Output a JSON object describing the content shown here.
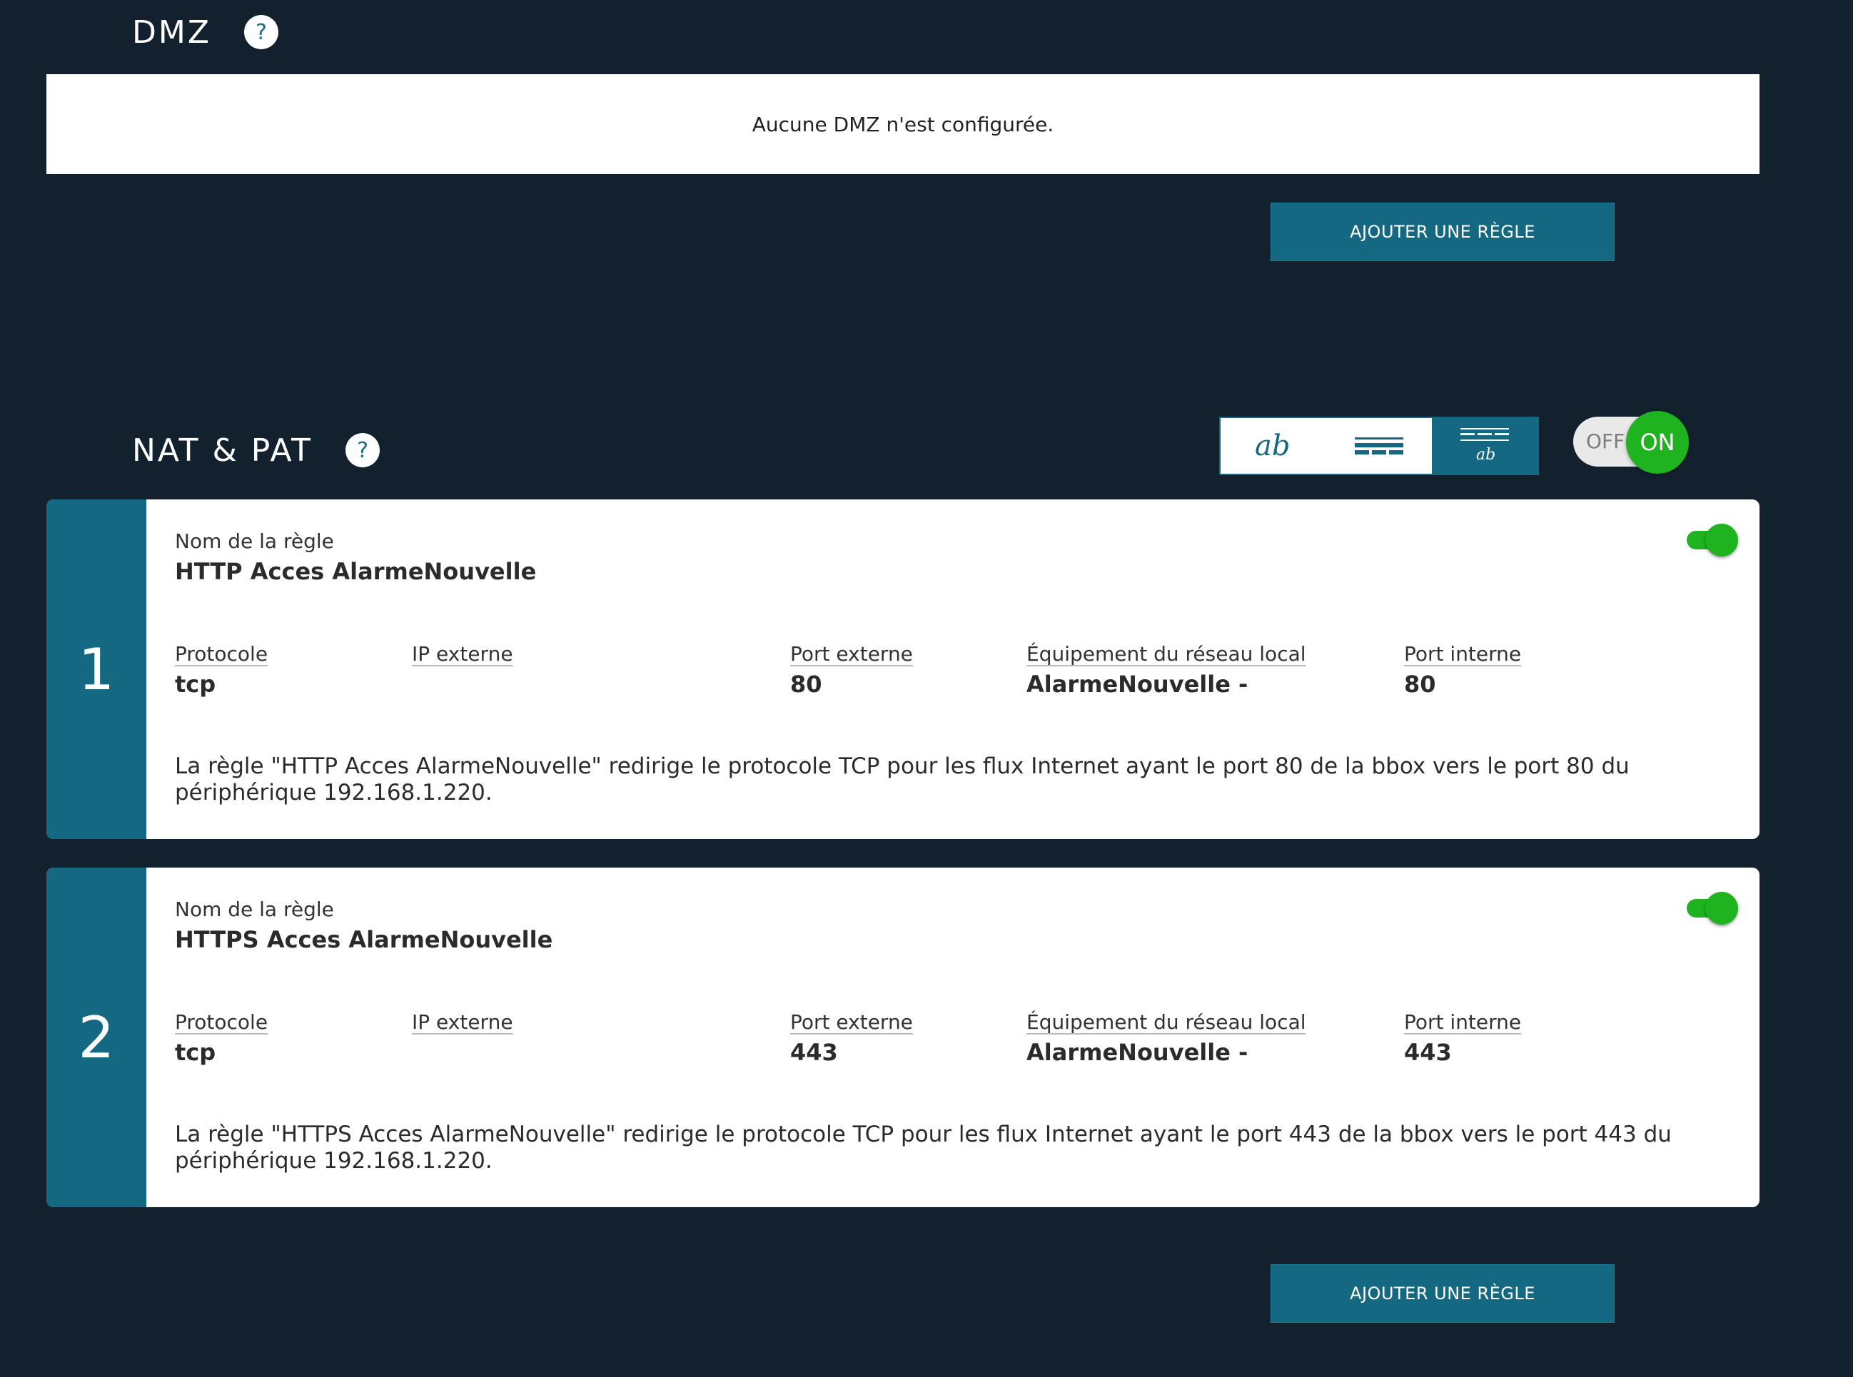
{
  "dmz": {
    "title": "DMZ",
    "help": "?",
    "empty_message": "Aucune DMZ n'est configurée.",
    "add_button": "AJOUTER UNE RÈGLE"
  },
  "nat": {
    "title": "NAT & PAT",
    "help": "?",
    "view_modes": [
      "text-view-icon",
      "table-view-icon",
      "mixed-view-icon"
    ],
    "active_view": "mixed-view-icon",
    "master_toggle": {
      "off_label": "OFF",
      "on_label": "ON",
      "state": "on"
    },
    "labels": {
      "rule_name": "Nom de la règle",
      "protocol": "Protocole",
      "external_ip": "IP externe",
      "external_port": "Port externe",
      "local_device": "Équipement du réseau local",
      "internal_port": "Port interne"
    },
    "rules": [
      {
        "number": "1",
        "name": "HTTP Acces AlarmeNouvelle",
        "protocol": "tcp",
        "external_ip": "",
        "external_port": "80",
        "local_device": "AlarmeNouvelle -",
        "internal_port": "80",
        "enabled": true,
        "description": "La règle \"HTTP Acces AlarmeNouvelle\" redirige le protocole TCP pour les flux Internet ayant le port 80 de la bbox vers le port 80 du périphérique 192.168.1.220."
      },
      {
        "number": "2",
        "name": "HTTPS Acces AlarmeNouvelle",
        "protocol": "tcp",
        "external_ip": "",
        "external_port": "443",
        "local_device": "AlarmeNouvelle -",
        "internal_port": "443",
        "enabled": true,
        "description": "La règle \"HTTPS Acces AlarmeNouvelle\" redirige le protocole TCP pour les flux Internet ayant le port 443 de la bbox vers le port 443 du périphérique 192.168.1.220."
      }
    ],
    "add_button": "AJOUTER UNE RÈGLE"
  },
  "colors": {
    "background": "#13212f",
    "accent": "#156882",
    "toggle_on": "#1fb31f"
  }
}
